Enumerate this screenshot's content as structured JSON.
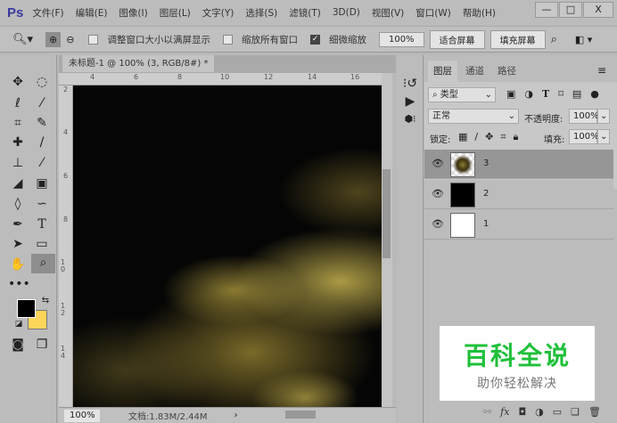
{
  "menubar": {
    "logo": "Ps",
    "items": [
      "文件(F)",
      "编辑(E)",
      "图像(I)",
      "图层(L)",
      "文字(Y)",
      "选择(S)",
      "滤镜(T)",
      "3D(D)",
      "视图(V)",
      "窗口(W)",
      "帮助(H)"
    ],
    "minimize": "—",
    "maximize": "□",
    "close": "X"
  },
  "options": {
    "resize_windows": "调整窗口大小以满屏显示",
    "zoom_all": "缩放所有窗口",
    "scrubby_zoom": "细微缩放",
    "zoom_value": "100%",
    "fit_screen": "适合屏幕",
    "fill_screen": "填充屏幕"
  },
  "document": {
    "tab_title": "未标题-1 @ 100% (3, RGB/8#) *",
    "close": "×",
    "ruler_top": [
      "4",
      "6",
      "8",
      "10",
      "12",
      "14",
      "16"
    ],
    "ruler_left": [
      "2",
      "4",
      "6",
      "8",
      "10",
      "12",
      "14"
    ],
    "zoom": "100%",
    "doc_info": "文档:1.83M/2.44M"
  },
  "colors": {
    "foreground": "#000000",
    "background": "#fdd55a"
  },
  "layers_panel": {
    "tabs": [
      "图层",
      "通道",
      "路径"
    ],
    "filter": "类型",
    "blend_mode": "正常",
    "opacity_label": "不透明度:",
    "opacity": "100%",
    "lock_label": "锁定:",
    "fill_label": "填充:",
    "fill": "100%",
    "layers": [
      {
        "name": "3",
        "selected": true
      },
      {
        "name": "2",
        "selected": false
      },
      {
        "name": "1",
        "selected": false
      }
    ]
  },
  "watermark": {
    "title": "百科全说",
    "subtitle": "助你轻松解决"
  }
}
